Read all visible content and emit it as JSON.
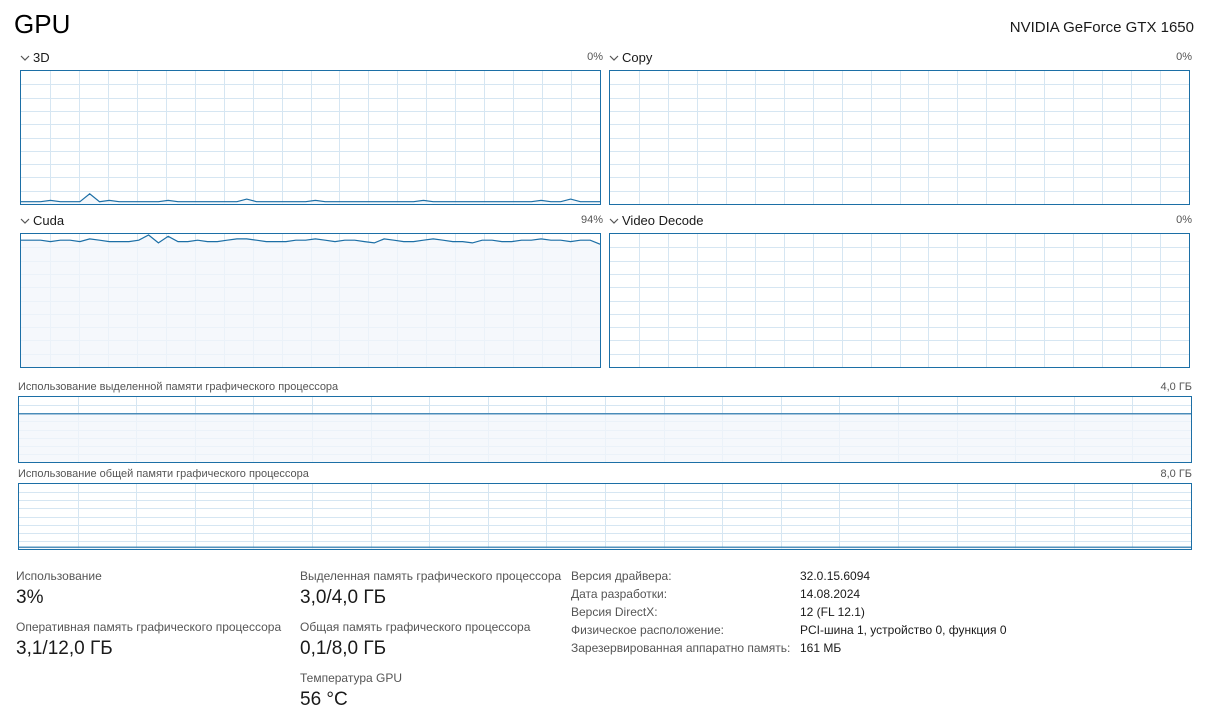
{
  "page": {
    "title": "GPU",
    "gpu_name": "NVIDIA GeForce GTX 1650"
  },
  "colors": {
    "accent": "#1c6fa6",
    "grid": "#d6e6f2",
    "fill": "#f1f6fb"
  },
  "engines": [
    {
      "label": "3D",
      "percent": "0%"
    },
    {
      "label": "Copy",
      "percent": "0%"
    },
    {
      "label": "Cuda",
      "percent": "94%"
    },
    {
      "label": "Video Decode",
      "percent": "0%"
    }
  ],
  "memory": {
    "dedicated_label": "Использование выделенной памяти графического процессора",
    "dedicated_max": "4,0 ГБ",
    "shared_label": "Использование общей памяти графического процессора",
    "shared_max": "8,0 ГБ"
  },
  "chart_data": [
    {
      "type": "area",
      "title": "3D",
      "ylim": [
        0,
        100
      ],
      "x": "60 samples",
      "values": [
        1,
        1,
        1,
        2,
        1,
        1,
        1,
        7,
        1,
        2,
        1,
        1,
        1,
        1,
        1,
        2,
        1,
        1,
        1,
        1,
        1,
        1,
        1,
        3,
        1,
        1,
        1,
        1,
        1,
        1,
        2,
        1,
        1,
        1,
        1,
        1,
        1,
        1,
        1,
        1,
        1,
        2,
        1,
        1,
        1,
        1,
        1,
        1,
        1,
        1,
        1,
        1,
        1,
        2,
        1,
        1,
        3,
        1,
        1,
        1
      ]
    },
    {
      "type": "area",
      "title": "Copy",
      "ylim": [
        0,
        100
      ],
      "values": []
    },
    {
      "type": "area",
      "title": "Cuda",
      "ylim": [
        0,
        100
      ],
      "values": [
        96,
        96,
        96,
        95,
        96,
        96,
        95,
        97,
        96,
        95,
        95,
        95,
        96,
        100,
        94,
        99,
        95,
        95,
        96,
        95,
        95,
        96,
        97,
        97,
        96,
        95,
        95,
        95,
        96,
        96,
        97,
        96,
        95,
        96,
        96,
        95,
        94,
        97,
        96,
        95,
        95,
        96,
        97,
        96,
        95,
        95,
        94,
        96,
        96,
        95,
        95,
        96,
        96,
        97,
        96,
        96,
        95,
        96,
        96,
        93
      ]
    },
    {
      "type": "area",
      "title": "Video Decode",
      "ylim": [
        0,
        100
      ],
      "values": []
    },
    {
      "type": "area",
      "title": "Использование выделенной памяти графического процессора",
      "ylim": [
        0,
        4.0
      ],
      "unit": "ГБ",
      "values_constant": 3.0
    },
    {
      "type": "area",
      "title": "Использование общей памяти графического процессора",
      "ylim": [
        0,
        8.0
      ],
      "unit": "ГБ",
      "values_constant": 0.1
    }
  ],
  "stats": {
    "usage_label": "Использование",
    "usage_value": "3%",
    "gpu_ram_label": "Оперативная память графического процессора",
    "gpu_ram_value": "3,1/12,0 ГБ",
    "dedicated_label": "Выделенная память графического процессора",
    "dedicated_value": "3,0/4,0 ГБ",
    "shared_label": "Общая память графического процессора",
    "shared_value": "0,1/8,0 ГБ",
    "temp_label": "Температура GPU",
    "temp_value": "56 °C"
  },
  "info": [
    {
      "label": "Версия драйвера:",
      "value": "32.0.15.6094"
    },
    {
      "label": "Дата разработки:",
      "value": "14.08.2024"
    },
    {
      "label": "Версия DirectX:",
      "value": "12 (FL 12.1)"
    },
    {
      "label": "Физическое расположение:",
      "value": "PCI-шина 1, устройство 0, функция 0"
    },
    {
      "label": "Зарезервированная аппаратно память:",
      "value": "161 МБ"
    }
  ]
}
